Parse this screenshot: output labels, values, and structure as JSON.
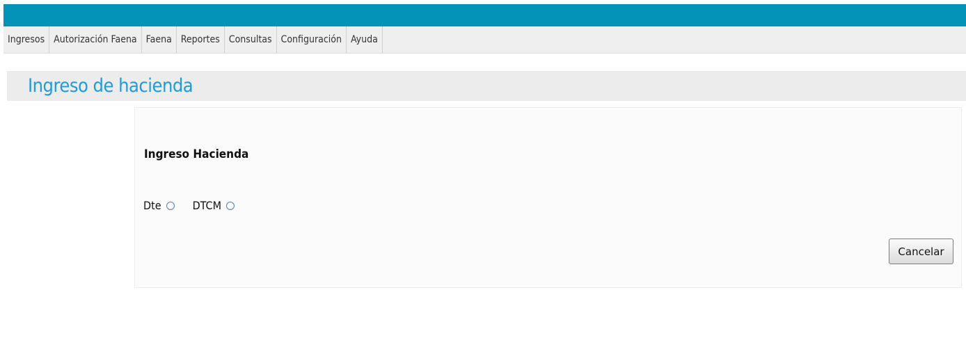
{
  "menu": {
    "items": [
      {
        "label": "Ingresos"
      },
      {
        "label": "Autorización Faena"
      },
      {
        "label": "Faena"
      },
      {
        "label": "Reportes"
      },
      {
        "label": "Consultas"
      },
      {
        "label": "Configuración"
      },
      {
        "label": "Ayuda"
      }
    ]
  },
  "page": {
    "title": "Ingreso de hacienda"
  },
  "form": {
    "section_title": "Ingreso Hacienda",
    "options": [
      {
        "label": "Dte",
        "selected": false
      },
      {
        "label": "DTCM",
        "selected": false
      }
    ],
    "cancel_label": "Cancelar"
  },
  "colors": {
    "header": "#0095b8",
    "title": "#1a9ce0"
  }
}
